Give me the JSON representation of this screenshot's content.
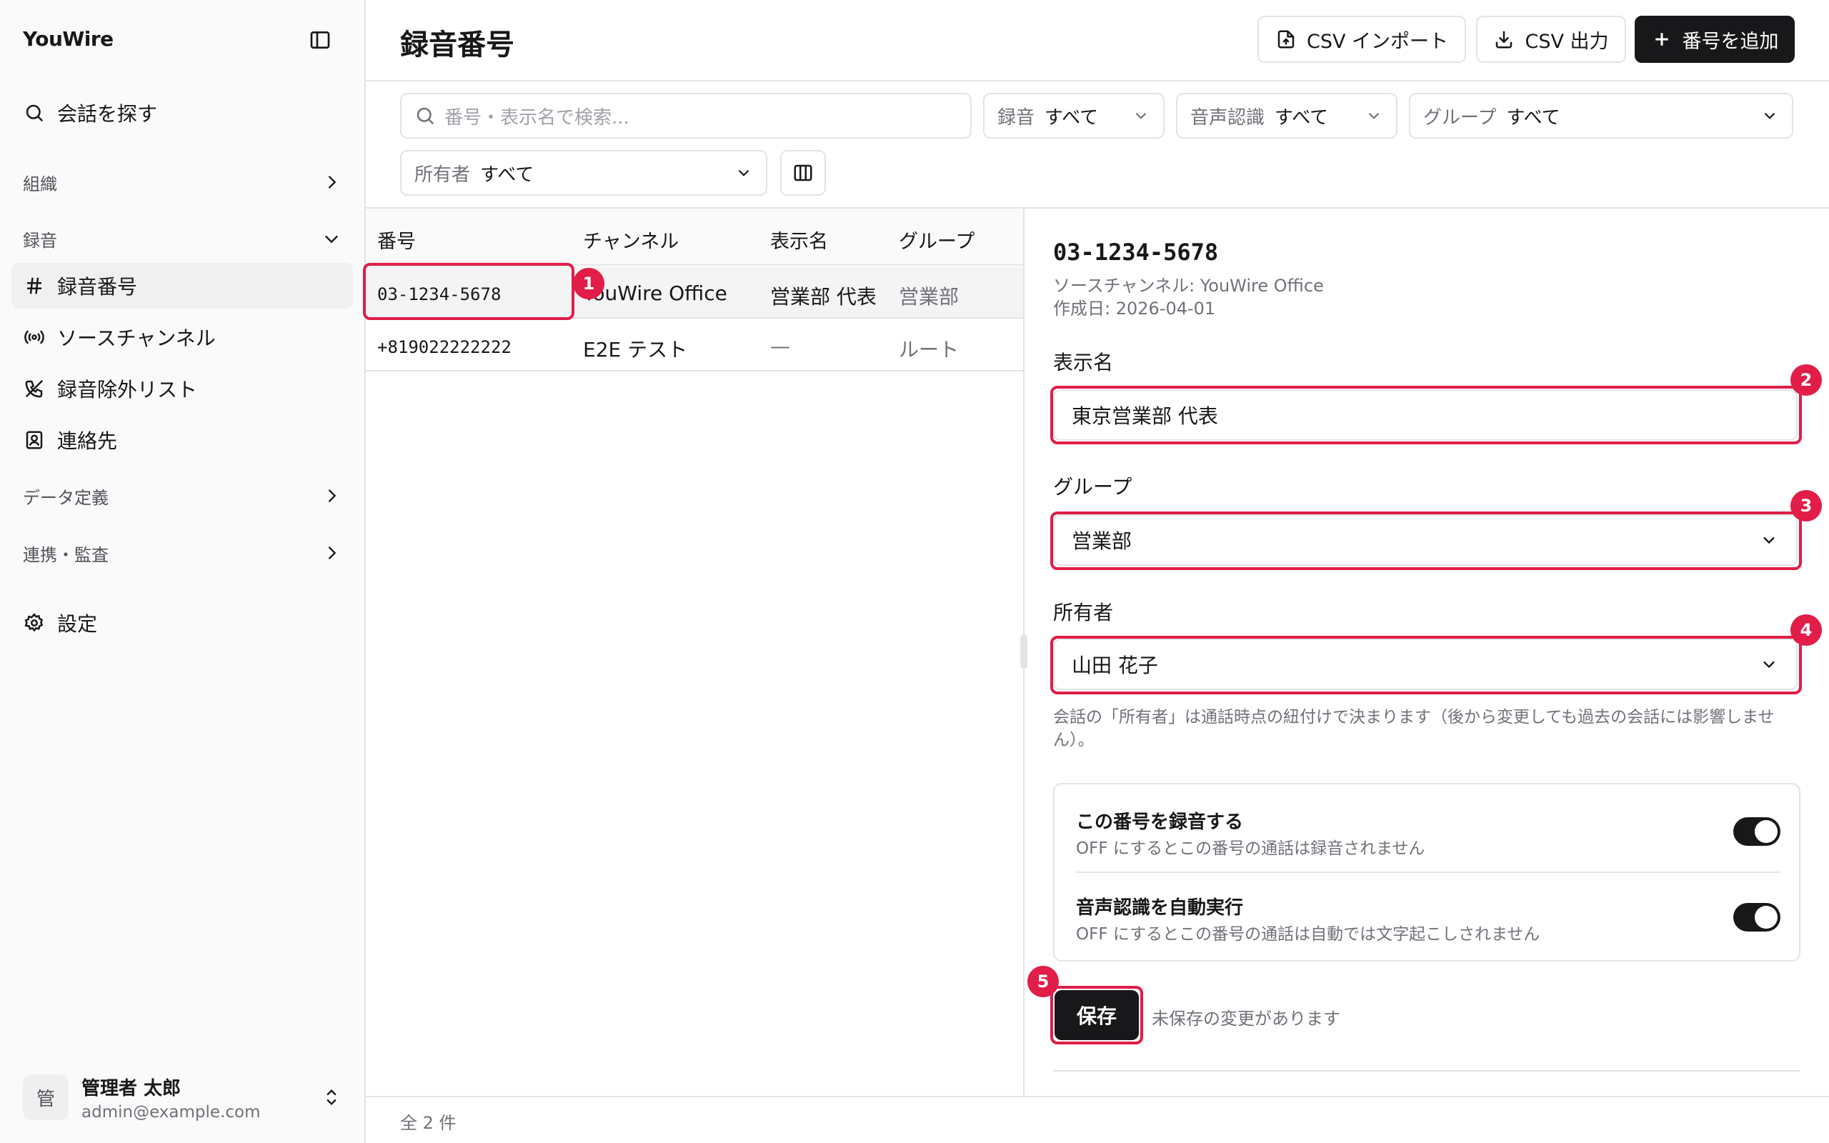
{
  "app": {
    "name": "YouWire"
  },
  "sidebar": {
    "search_label": "会話を探す",
    "sections": {
      "org": "組織",
      "recording": "録音",
      "data_def": "データ定義",
      "integration": "連携・監査"
    },
    "items": {
      "numbers": "録音番号",
      "source_channels": "ソースチャンネル",
      "exclusions": "録音除外リスト",
      "contacts": "連絡先"
    },
    "settings": "設定",
    "user": {
      "avatar": "管",
      "name": "管理者 太郎",
      "email": "admin@example.com"
    }
  },
  "header": {
    "title": "録音番号",
    "csv_import": "CSV インポート",
    "csv_export": "CSV 出力",
    "add_number": "番号を追加"
  },
  "filters": {
    "search_placeholder": "番号・表示名で検索...",
    "recording": {
      "label": "録音",
      "value": "すべて"
    },
    "asr": {
      "label": "音声認識",
      "value": "すべて"
    },
    "group": {
      "label": "グループ",
      "value": "すべて"
    },
    "owner": {
      "label": "所有者",
      "value": "すべて"
    }
  },
  "table": {
    "columns": [
      "番号",
      "チャンネル",
      "表示名",
      "グループ"
    ],
    "rows": [
      {
        "number": "03-1234-5678",
        "channel": "YouWire Office",
        "display_name": "営業部 代表",
        "group": "営業部"
      },
      {
        "number": "+819022222222",
        "channel": "E2E テスト",
        "display_name": "—",
        "group": "ルート"
      }
    ],
    "total": "全 2 件"
  },
  "detail": {
    "number": "03-1234-5678",
    "source": "ソースチャンネル: YouWire Office",
    "created": "作成日: 2026-04-01",
    "display_name_label": "表示名",
    "display_name_value": "東京営業部 代表",
    "group_label": "グループ",
    "group_value": "営業部",
    "owner_label": "所有者",
    "owner_value": "山田 花子",
    "owner_help": "会話の「所有者」は通話時点の紐付けで決まります（後から変更しても過去の会話には影響しません）。",
    "toggles": [
      {
        "title": "この番号を録音する",
        "desc": "OFF にするとこの番号の通話は録音されません",
        "on": true
      },
      {
        "title": "音声認識を自動実行",
        "desc": "OFF にするとこの番号の通話は自動では文字起こしされません",
        "on": true
      }
    ],
    "save": "保存",
    "unsaved": "未保存の変更があります"
  },
  "annotations": [
    "1",
    "2",
    "3",
    "4",
    "5"
  ],
  "colors": {
    "accent": "#e11d48",
    "primary": "#18181b"
  }
}
